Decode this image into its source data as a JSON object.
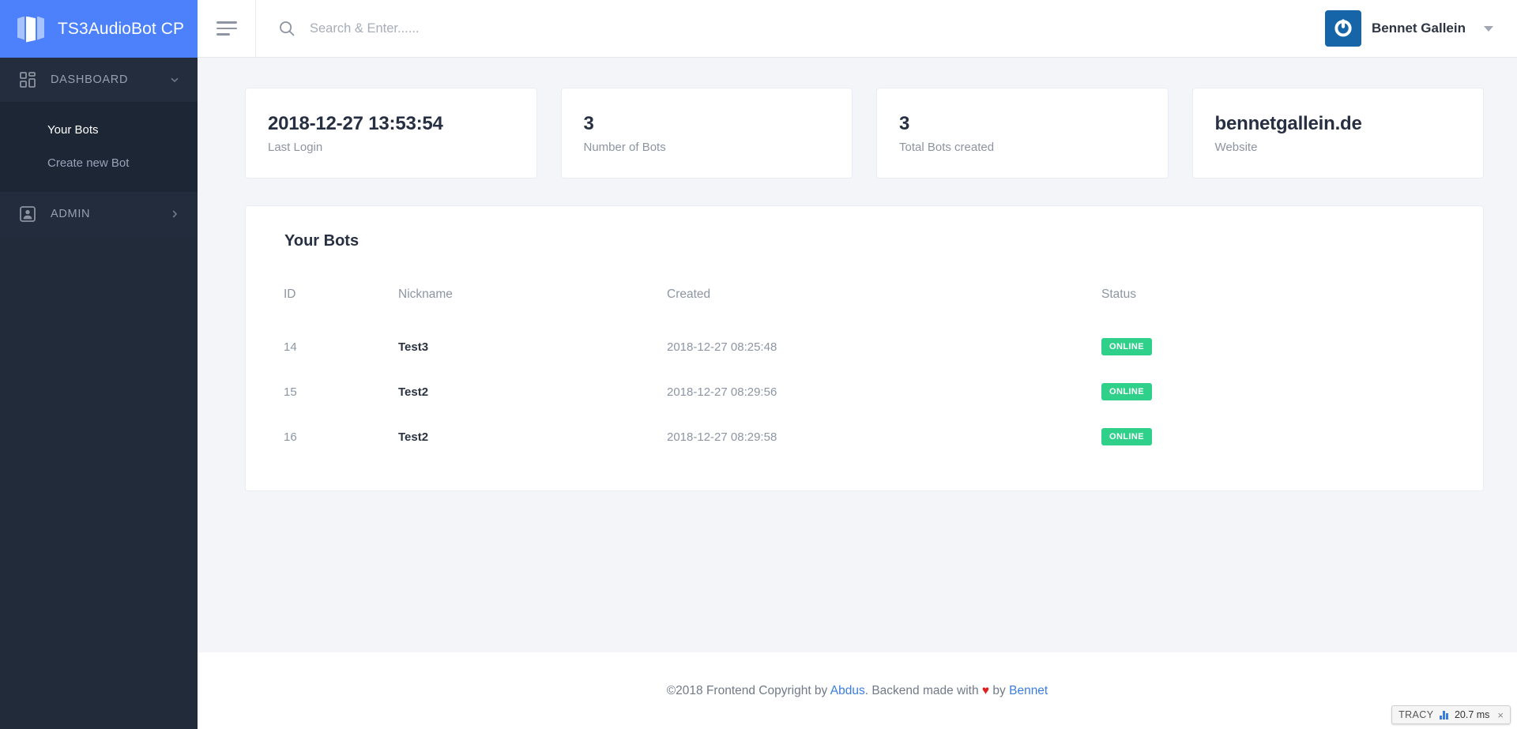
{
  "sidebar": {
    "brand": {
      "title": "TS3AudioBot CP",
      "logo_icon": "panels-logo-icon"
    },
    "groups": [
      {
        "label": "DASHBOARD",
        "icon": "grid-icon",
        "chevron": "chevron-down-icon",
        "expanded": true,
        "items": [
          {
            "label": "Your Bots",
            "active": true
          },
          {
            "label": "Create new Bot",
            "active": false
          }
        ]
      },
      {
        "label": "ADMIN",
        "icon": "user-badge-icon",
        "chevron": "chevron-right-icon",
        "expanded": false,
        "items": []
      }
    ]
  },
  "topbar": {
    "menu_toggle_icon": "hamburger-icon",
    "search": {
      "icon": "search-icon",
      "value": "",
      "placeholder": "Search & Enter......"
    },
    "user": {
      "name": "Bennet Gallein",
      "avatar_icon": "gravatar-power-icon",
      "caret_icon": "caret-down-icon"
    }
  },
  "stats": [
    {
      "value": "2018-12-27 13:53:54",
      "label": "Last Login"
    },
    {
      "value": "3",
      "label": "Number of Bots"
    },
    {
      "value": "3",
      "label": "Total Bots created"
    },
    {
      "value": "bennetgallein.de",
      "label": "Website"
    }
  ],
  "panel": {
    "title": "Your Bots",
    "columns": [
      "ID",
      "Nickname",
      "Created",
      "Status"
    ],
    "rows": [
      {
        "id": "14",
        "nickname": "Test3",
        "created": "2018-12-27 08:25:48",
        "status": "ONLINE"
      },
      {
        "id": "15",
        "nickname": "Test2",
        "created": "2018-12-27 08:29:56",
        "status": "ONLINE"
      },
      {
        "id": "16",
        "nickname": "Test2",
        "created": "2018-12-27 08:29:58",
        "status": "ONLINE"
      }
    ]
  },
  "footer": {
    "text_1": "©2018 Frontend Copyright by ",
    "link_1": "Abdus",
    "text_2": ". Backend made with ",
    "heart": "♥",
    "text_3": " by ",
    "link_2": "Bennet"
  },
  "debugbar": {
    "label": "TRACY",
    "icon": "bar-chart-icon",
    "time": "20.7 ms",
    "close_icon": "close-icon",
    "close_glyph": "×"
  },
  "colors": {
    "brand_blue": "#4c81fb",
    "sidebar_bg": "#212b3a",
    "sidebar_submenu_bg": "#1d2634",
    "page_bg": "#f4f5f9",
    "status_green": "#2fd08a",
    "link_blue": "#3b7ddd",
    "heart_red": "#e02020",
    "avatar_blue": "#1565a8"
  }
}
